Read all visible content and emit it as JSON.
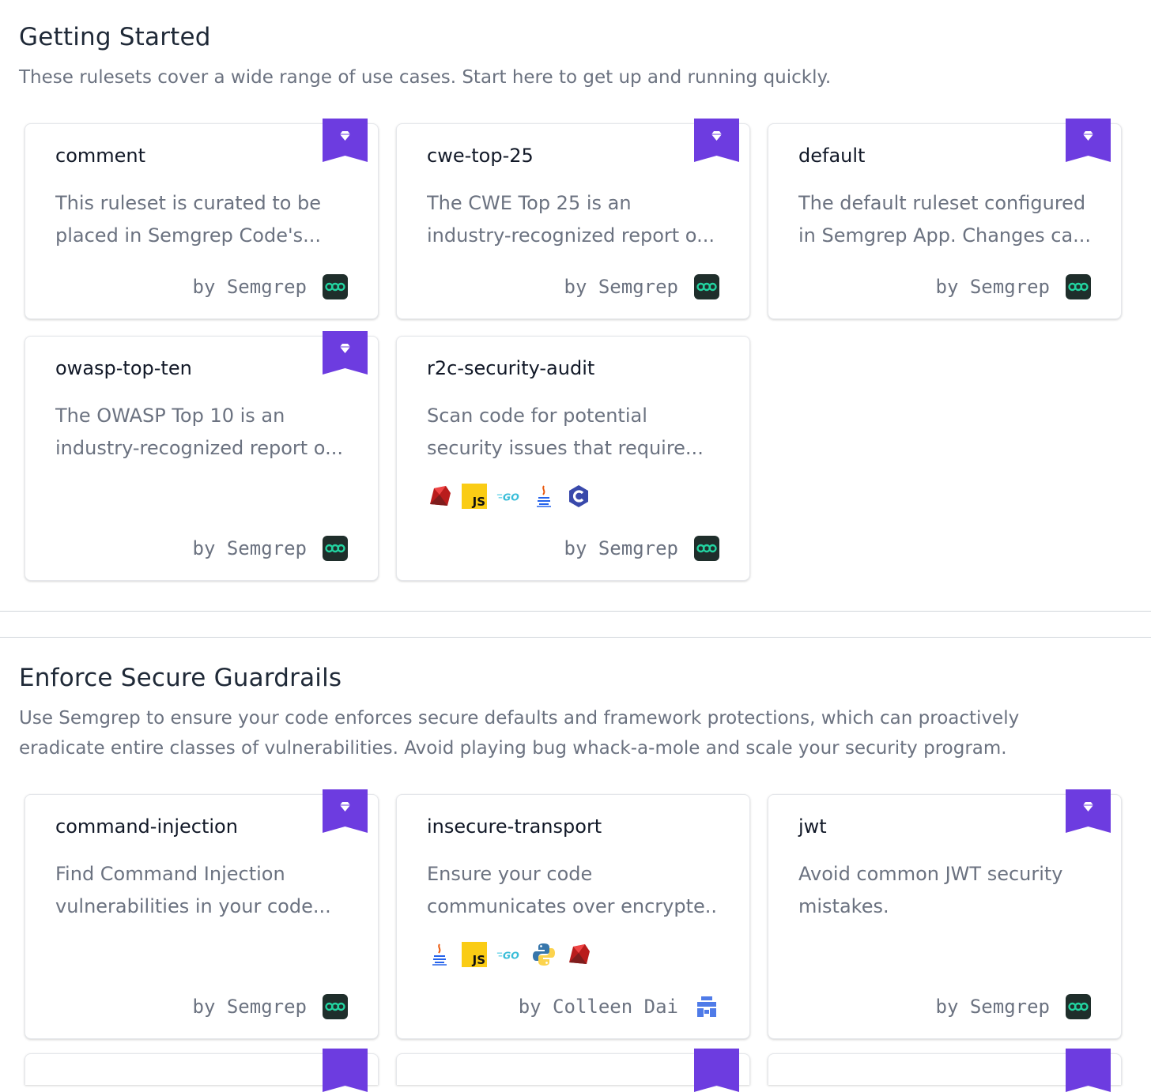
{
  "colors": {
    "pro_ribbon": "#6d3ce0",
    "semgrep_logo_bg": "#1f2e2b",
    "semgrep_logo_fg": "#22d3a0"
  },
  "sections": [
    {
      "title": "Getting Started",
      "description": "These rulesets cover a wide range of use cases. Start here to get up and running quickly.",
      "cards": [
        {
          "title": "comment",
          "desc_line1": "This ruleset is curated to be",
          "desc_line2": "placed in Semgrep Code's...",
          "author": "by Semgrep",
          "author_icon": "semgrep-logo-icon",
          "pro": true
        },
        {
          "title": "cwe-top-25",
          "desc_line1": "The CWE Top 25 is an",
          "desc_line2": "industry-recognized report o...",
          "author": "by Semgrep",
          "author_icon": "semgrep-logo-icon",
          "pro": true
        },
        {
          "title": "default",
          "desc_line1": "The default ruleset configured",
          "desc_line2": "in Semgrep App. Changes ca...",
          "author": "by Semgrep",
          "author_icon": "semgrep-logo-icon",
          "pro": true
        },
        {
          "title": "owasp-top-ten",
          "desc_line1": "The OWASP Top 10 is an",
          "desc_line2": "industry-recognized report o...",
          "author": "by Semgrep",
          "author_icon": "semgrep-logo-icon",
          "pro": true
        },
        {
          "title": "r2c-security-audit",
          "desc_line1": "Scan code for potential",
          "desc_line2": "security issues that require...",
          "author": "by Semgrep",
          "author_icon": "semgrep-logo-icon",
          "pro": false,
          "languages": [
            "ruby-icon",
            "javascript-icon",
            "go-icon",
            "java-icon",
            "c-icon"
          ]
        }
      ]
    },
    {
      "title": "Enforce Secure Guardrails",
      "description": "Use Semgrep to ensure your code enforces secure defaults and framework protections, which can proactively eradicate entire classes of vulnerabilities. Avoid playing bug whack-a-mole and scale your security program.",
      "cards": [
        {
          "title": "command-injection",
          "desc_line1": "Find Command Injection",
          "desc_line2": "vulnerabilities in your code...",
          "author": "by Semgrep",
          "author_icon": "semgrep-logo-icon",
          "pro": true
        },
        {
          "title": "insecure-transport",
          "desc_line1": "Ensure your code",
          "desc_line2": "communicates over encrypte...",
          "author": "by Colleen Dai",
          "author_icon": "user-avatar-icon",
          "pro": false,
          "languages": [
            "java-icon",
            "javascript-icon",
            "go-icon",
            "python-icon",
            "ruby-icon"
          ]
        },
        {
          "title": "jwt",
          "desc_line1": "Avoid common JWT security",
          "desc_line2": "mistakes.",
          "author": "by Semgrep",
          "author_icon": "semgrep-logo-icon",
          "pro": true
        }
      ]
    }
  ]
}
